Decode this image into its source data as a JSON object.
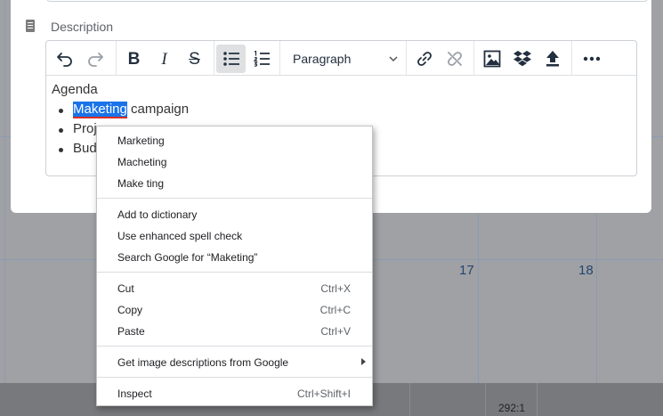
{
  "calendar": {
    "day_numbers": [
      "17",
      "18"
    ],
    "footer_time": "292:1"
  },
  "modal": {
    "description_label": "Description"
  },
  "toolbar": {
    "block_format": "Paragraph",
    "icons": [
      "undo-icon",
      "redo-icon",
      "bold-icon",
      "italic-icon",
      "strikethrough-icon",
      "bullet-list-icon",
      "numbered-list-icon",
      "link-icon",
      "unlink-icon",
      "image-icon",
      "dropbox-icon",
      "upload-icon",
      "more-icon"
    ],
    "labels": {
      "bold": "B",
      "italic": "I",
      "strike": "S"
    }
  },
  "editor": {
    "paragraph": "Agenda",
    "bullets": [
      {
        "selected": "Maketing",
        "rest": " campaign"
      },
      {
        "text": "Proj"
      },
      {
        "text": "Bud"
      }
    ]
  },
  "context_menu": {
    "suggestions": [
      "Marketing",
      "Macheting",
      "Make ting"
    ],
    "spell": [
      "Add to dictionary",
      "Use enhanced spell check",
      "Search Google for “Maketing”"
    ],
    "edit": [
      {
        "label": "Cut",
        "shortcut": "Ctrl+X"
      },
      {
        "label": "Copy",
        "shortcut": "Ctrl+C"
      },
      {
        "label": "Paste",
        "shortcut": "Ctrl+V"
      }
    ],
    "image_descriptions": "Get image descriptions from Google",
    "inspect": {
      "label": "Inspect",
      "shortcut": "Ctrl+Shift+I"
    }
  },
  "colors": {
    "selection": "#1a73e8",
    "spell_underline": "#d93025",
    "toolbar_active": "#dee0e2"
  }
}
